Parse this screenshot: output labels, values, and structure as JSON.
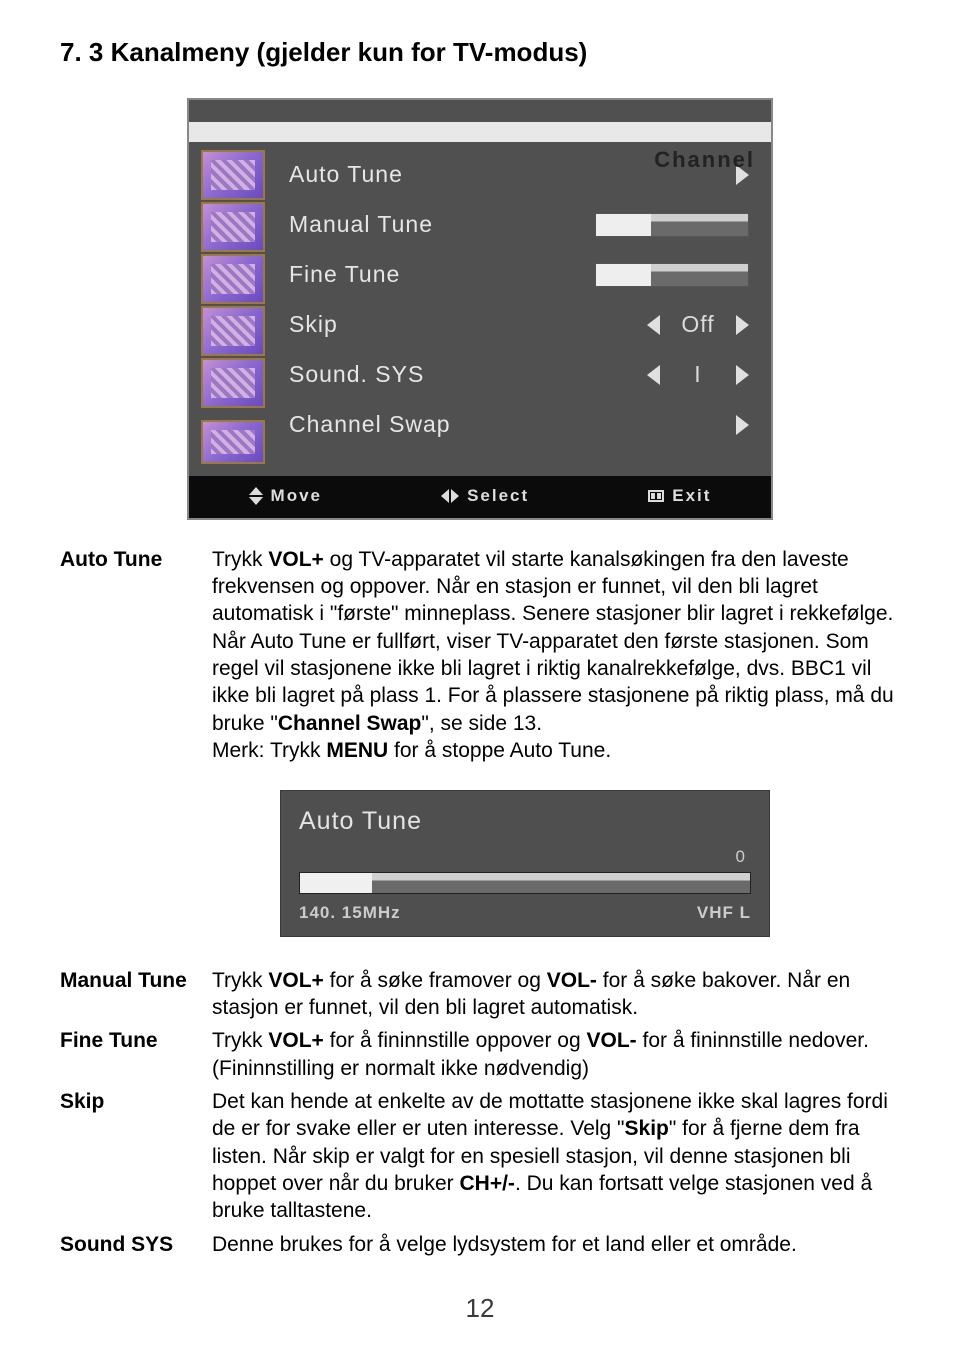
{
  "heading": "7. 3 Kanalmeny (gjelder kun for TV-modus)",
  "osd": {
    "title": "Channel",
    "items": [
      {
        "label": "Auto Tune",
        "widget": "arrow-right"
      },
      {
        "label": "Manual Tune",
        "widget": "bar"
      },
      {
        "label": "Fine Tune",
        "widget": "bar"
      },
      {
        "label": "Skip",
        "widget": "lr-value",
        "value": "Off"
      },
      {
        "label": "Sound. SYS",
        "widget": "lr-value",
        "value": "I"
      },
      {
        "label": "Channel Swap",
        "widget": "arrow-right"
      }
    ],
    "footer": {
      "move": "Move",
      "select": "Select",
      "exit": "Exit"
    }
  },
  "defs1": {
    "term": "Auto Tune",
    "body_html": "Trykk <b>VOL+</b> og TV-apparatet vil starte kanalsøkingen fra den laveste frekvensen og oppover. Når en stasjon er funnet, vil den bli lagret automatisk i \"første\" minneplass. Senere stasjoner blir lagret i rekkefølge. Når Auto Tune er fullført, viser TV-apparatet den første stasjonen. Som regel vil stasjonene ikke bli lagret i riktig kanalrekkefølge, dvs. BBC1 vil ikke bli lagret på plass 1. For å plassere stasjonene på riktig plass, må du bruke \"<b>Channel Swap</b>\", se side 13.<br>Merk: Trykk <b>MENU</b> for å stoppe Auto Tune."
  },
  "autotune_box": {
    "title": "Auto Tune",
    "count": "0",
    "freq": "140. 15MHz",
    "band": "VHF L"
  },
  "defs2": [
    {
      "term": "Manual Tune",
      "body_html": "Trykk <b>VOL+</b> for å søke framover og <b>VOL-</b> for å søke bakover. Når en stasjon er funnet, vil den bli lagret automatisk."
    },
    {
      "term": "Fine Tune",
      "body_html": "Trykk <b>VOL+</b> for å fininnstille oppover og <b>VOL-</b> for å fininnstille nedover. (Fininnstilling er normalt ikke nødvendig)"
    },
    {
      "term": "Skip",
      "body_html": "Det kan hende at enkelte av de mottatte stasjonene ikke skal lagres fordi de er for svake eller er uten interesse. Velg \"<b>Skip</b>\" for å fjerne dem fra listen. Når skip er valgt for en spesiell stasjon, vil denne stasjonen bli hoppet over når du bruker <b>CH+/-</b>. Du kan fortsatt velge stasjonen ved å bruke talltastene."
    },
    {
      "term": "Sound SYS",
      "body_html": "Denne brukes for å velge lydsystem for et land eller et område."
    }
  ],
  "page_number": "12"
}
